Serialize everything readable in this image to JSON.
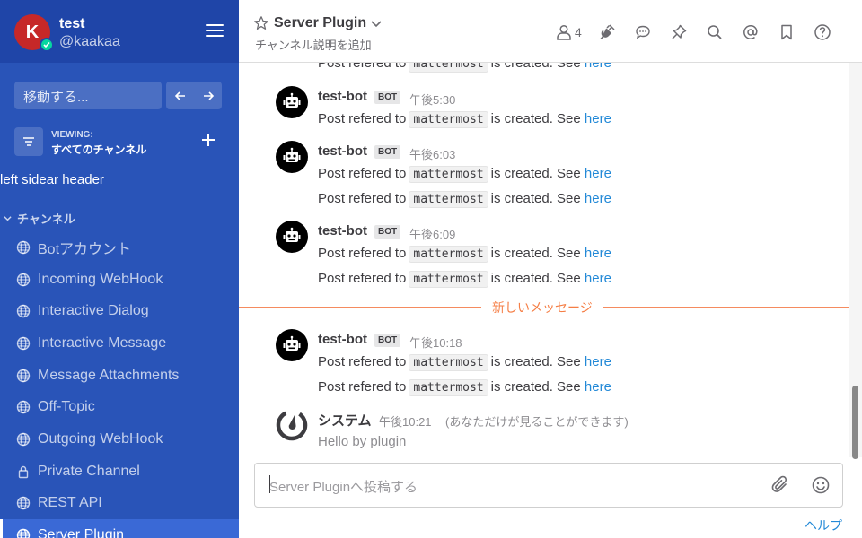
{
  "user": {
    "initial": "K",
    "name": "test",
    "handle": "@kaakaa"
  },
  "sidebar": {
    "jump_placeholder": "移動する...",
    "viewing_label": "VIEWING:",
    "viewing_value": "すべてのチャンネル",
    "custom_header": "left sidear header",
    "category": "チャンネル",
    "channels": [
      {
        "label": "Botアカウント",
        "icon": "globe-icon"
      },
      {
        "label": "Incoming WebHook",
        "icon": "globe-icon"
      },
      {
        "label": "Interactive Dialog",
        "icon": "globe-icon"
      },
      {
        "label": "Interactive Message",
        "icon": "globe-icon"
      },
      {
        "label": "Message Attachments",
        "icon": "globe-icon"
      },
      {
        "label": "Off-Topic",
        "icon": "globe-icon"
      },
      {
        "label": "Outgoing WebHook",
        "icon": "globe-icon"
      },
      {
        "label": "Private Channel",
        "icon": "lock-icon"
      },
      {
        "label": "REST API",
        "icon": "globe-icon"
      },
      {
        "label": "Server Plugin",
        "icon": "globe-icon",
        "active": true
      }
    ]
  },
  "channel": {
    "name": "Server Plugin",
    "description": "チャンネル説明を追加",
    "member_count": "4"
  },
  "posts": {
    "partial_line": {
      "pre": "Post refered to",
      "code": "mattermost",
      "mid": "is created. See",
      "link": "here"
    },
    "groups": [
      {
        "author": "test-bot",
        "tag": "BOT",
        "time": "午後5:30",
        "lines": [
          {
            "pre": "Post refered to",
            "code": "mattermost",
            "mid": "is created. See",
            "link": "here"
          }
        ]
      },
      {
        "author": "test-bot",
        "tag": "BOT",
        "time": "午後6:03",
        "lines": [
          {
            "pre": "Post refered to",
            "code": "mattermost",
            "mid": "is created. See",
            "link": "here"
          },
          {
            "pre": "Post refered to",
            "code": "mattermost",
            "mid": "is created. See",
            "link": "here"
          }
        ]
      },
      {
        "author": "test-bot",
        "tag": "BOT",
        "time": "午後6:09",
        "lines": [
          {
            "pre": "Post refered to",
            "code": "mattermost",
            "mid": "is created. See",
            "link": "here"
          },
          {
            "pre": "Post refered to",
            "code": "mattermost",
            "mid": "is created. See",
            "link": "here"
          }
        ]
      },
      {
        "author": "test-bot",
        "tag": "BOT",
        "time": "午後10:18",
        "lines": [
          {
            "pre": "Post refered to",
            "code": "mattermost",
            "mid": "is created. See",
            "link": "here"
          },
          {
            "pre": "Post refered to",
            "code": "mattermost",
            "mid": "is created. See",
            "link": "here"
          }
        ]
      }
    ],
    "new_messages_label": "新しいメッセージ",
    "system": {
      "author": "システム",
      "time": "午後10:21",
      "ephemeral": "(あなただけが見ることができます)",
      "text": "Hello by plugin"
    }
  },
  "composer": {
    "placeholder": "Server Pluginへ投稿する"
  },
  "footer": {
    "help": "ヘルプ"
  },
  "colors": {
    "sidebar_bg": "#2954b8",
    "sidebar_header": "#1f45a8",
    "link": "#2389d7",
    "new_messages": "#f57e45",
    "avatar": "#c62828",
    "online": "#06d6a0"
  }
}
